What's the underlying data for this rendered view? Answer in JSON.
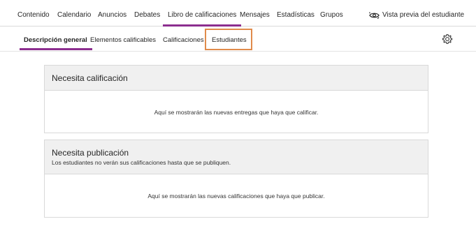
{
  "top_nav": {
    "tabs": [
      {
        "label": "Contenido",
        "active": false
      },
      {
        "label": "Calendario",
        "active": false
      },
      {
        "label": "Anuncios",
        "active": false
      },
      {
        "label": "Debates",
        "active": false
      },
      {
        "label": "Libro de calificaciones",
        "active": true
      },
      {
        "label": "Mensajes",
        "active": false
      },
      {
        "label": "Estadísticas",
        "active": false
      },
      {
        "label": "Grupos",
        "active": false
      }
    ],
    "student_preview": {
      "label": "Vista previa del estudiante",
      "icon": "eye-refresh-icon"
    },
    "active_underline_color": "#8c2e8f"
  },
  "sub_nav": {
    "tabs": [
      {
        "label": "Descripción general",
        "active": true
      },
      {
        "label": "Elementos calificables",
        "active": false
      },
      {
        "label": "Calificaciones",
        "active": false
      },
      {
        "label": "Estudiantes",
        "active": false,
        "highlighted": true
      }
    ],
    "settings_icon": "gear-icon",
    "highlight_color": "#e08b4b"
  },
  "cards": {
    "needs_grading": {
      "title": "Necesita calificación",
      "empty_message": "Aquí se mostrarán las nuevas entregas que haya que calificar."
    },
    "needs_posting": {
      "title": "Necesita publicación",
      "subtitle": "Los estudiantes no verán sus calificaciones hasta que se publiquen.",
      "empty_message": "Aquí se mostrarán las nuevas calificaciones que haya que publicar."
    }
  }
}
